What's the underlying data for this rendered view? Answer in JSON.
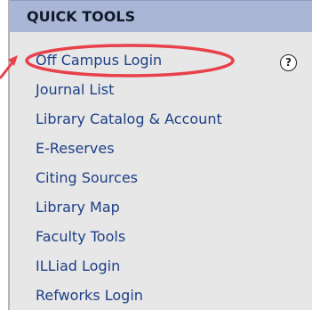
{
  "panel": {
    "title": "QUICK TOOLS",
    "items": [
      {
        "label": "Off Campus Login"
      },
      {
        "label": "Journal List"
      },
      {
        "label": "Library Catalog & Account"
      },
      {
        "label": "E-Reserves"
      },
      {
        "label": "Citing Sources"
      },
      {
        "label": "Library Map"
      },
      {
        "label": "Faculty Tools"
      },
      {
        "label": "ILLiad Login"
      },
      {
        "label": "Refworks Login"
      }
    ],
    "help_icon": {
      "glyph": "?",
      "icon": "help-icon"
    }
  },
  "annotation": {
    "highlighted_item": "Off Campus Login",
    "color": "#e8414b"
  },
  "colors": {
    "header_bg": "#aab6d6",
    "panel_bg": "#e7e7e7",
    "link": "#1d3f87"
  }
}
